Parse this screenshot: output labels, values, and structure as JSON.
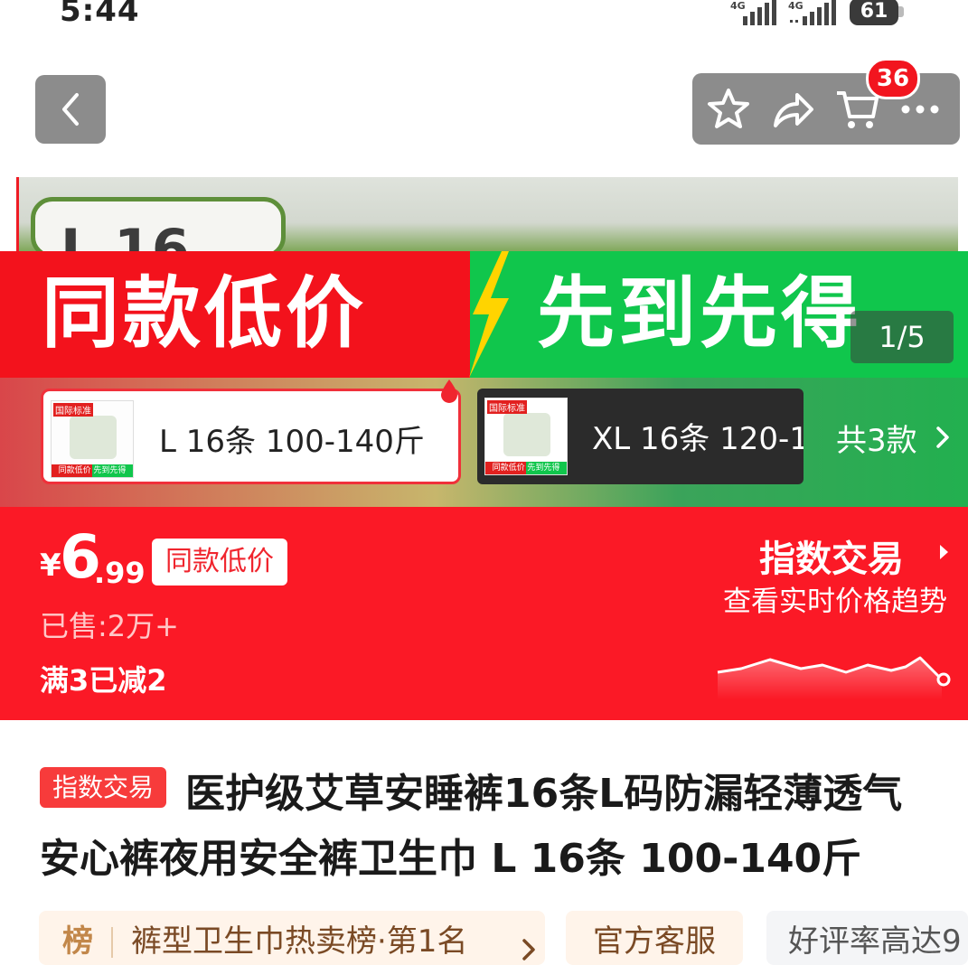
{
  "status_bar": {
    "time": "5:44",
    "network_1": "4G",
    "network_2": "4G",
    "battery": "61"
  },
  "nav": {
    "cart_count": "36"
  },
  "hero": {
    "card_text": "L 16",
    "banner_left": "同款低价",
    "banner_right": "先到先得",
    "image_counter": "1/5"
  },
  "sku": {
    "selected_label": "L 16条 100-140斤",
    "other_label": "XL 16条 120-1",
    "total": "共3款",
    "thumb_tag": "国际标准",
    "thumb_foot": "同款低价 先到先得"
  },
  "price": {
    "currency": "¥",
    "integer": "6",
    "decimal": ".99",
    "badge": "同款低价",
    "sold": "已售:2万+",
    "promo": "满3已减2",
    "index_title": "指数交易",
    "index_subtitle": "查看实时价格趋势"
  },
  "product": {
    "tag": "指数交易",
    "title_line1": "医护级艾草安睡裤16条L码防漏轻薄透气",
    "title_line2": "安心裤夜用安全裤卫生巾 L 16条 100-140斤"
  },
  "chips": {
    "rank_icon": "榜",
    "rank_text": "裤型卫生巾热卖榜·第1名",
    "service": "官方客服",
    "rating": "好评率高达9"
  },
  "colors": {
    "red": "#fb1926",
    "green": "#10c64c",
    "gray_button": "#8c8c8c"
  }
}
